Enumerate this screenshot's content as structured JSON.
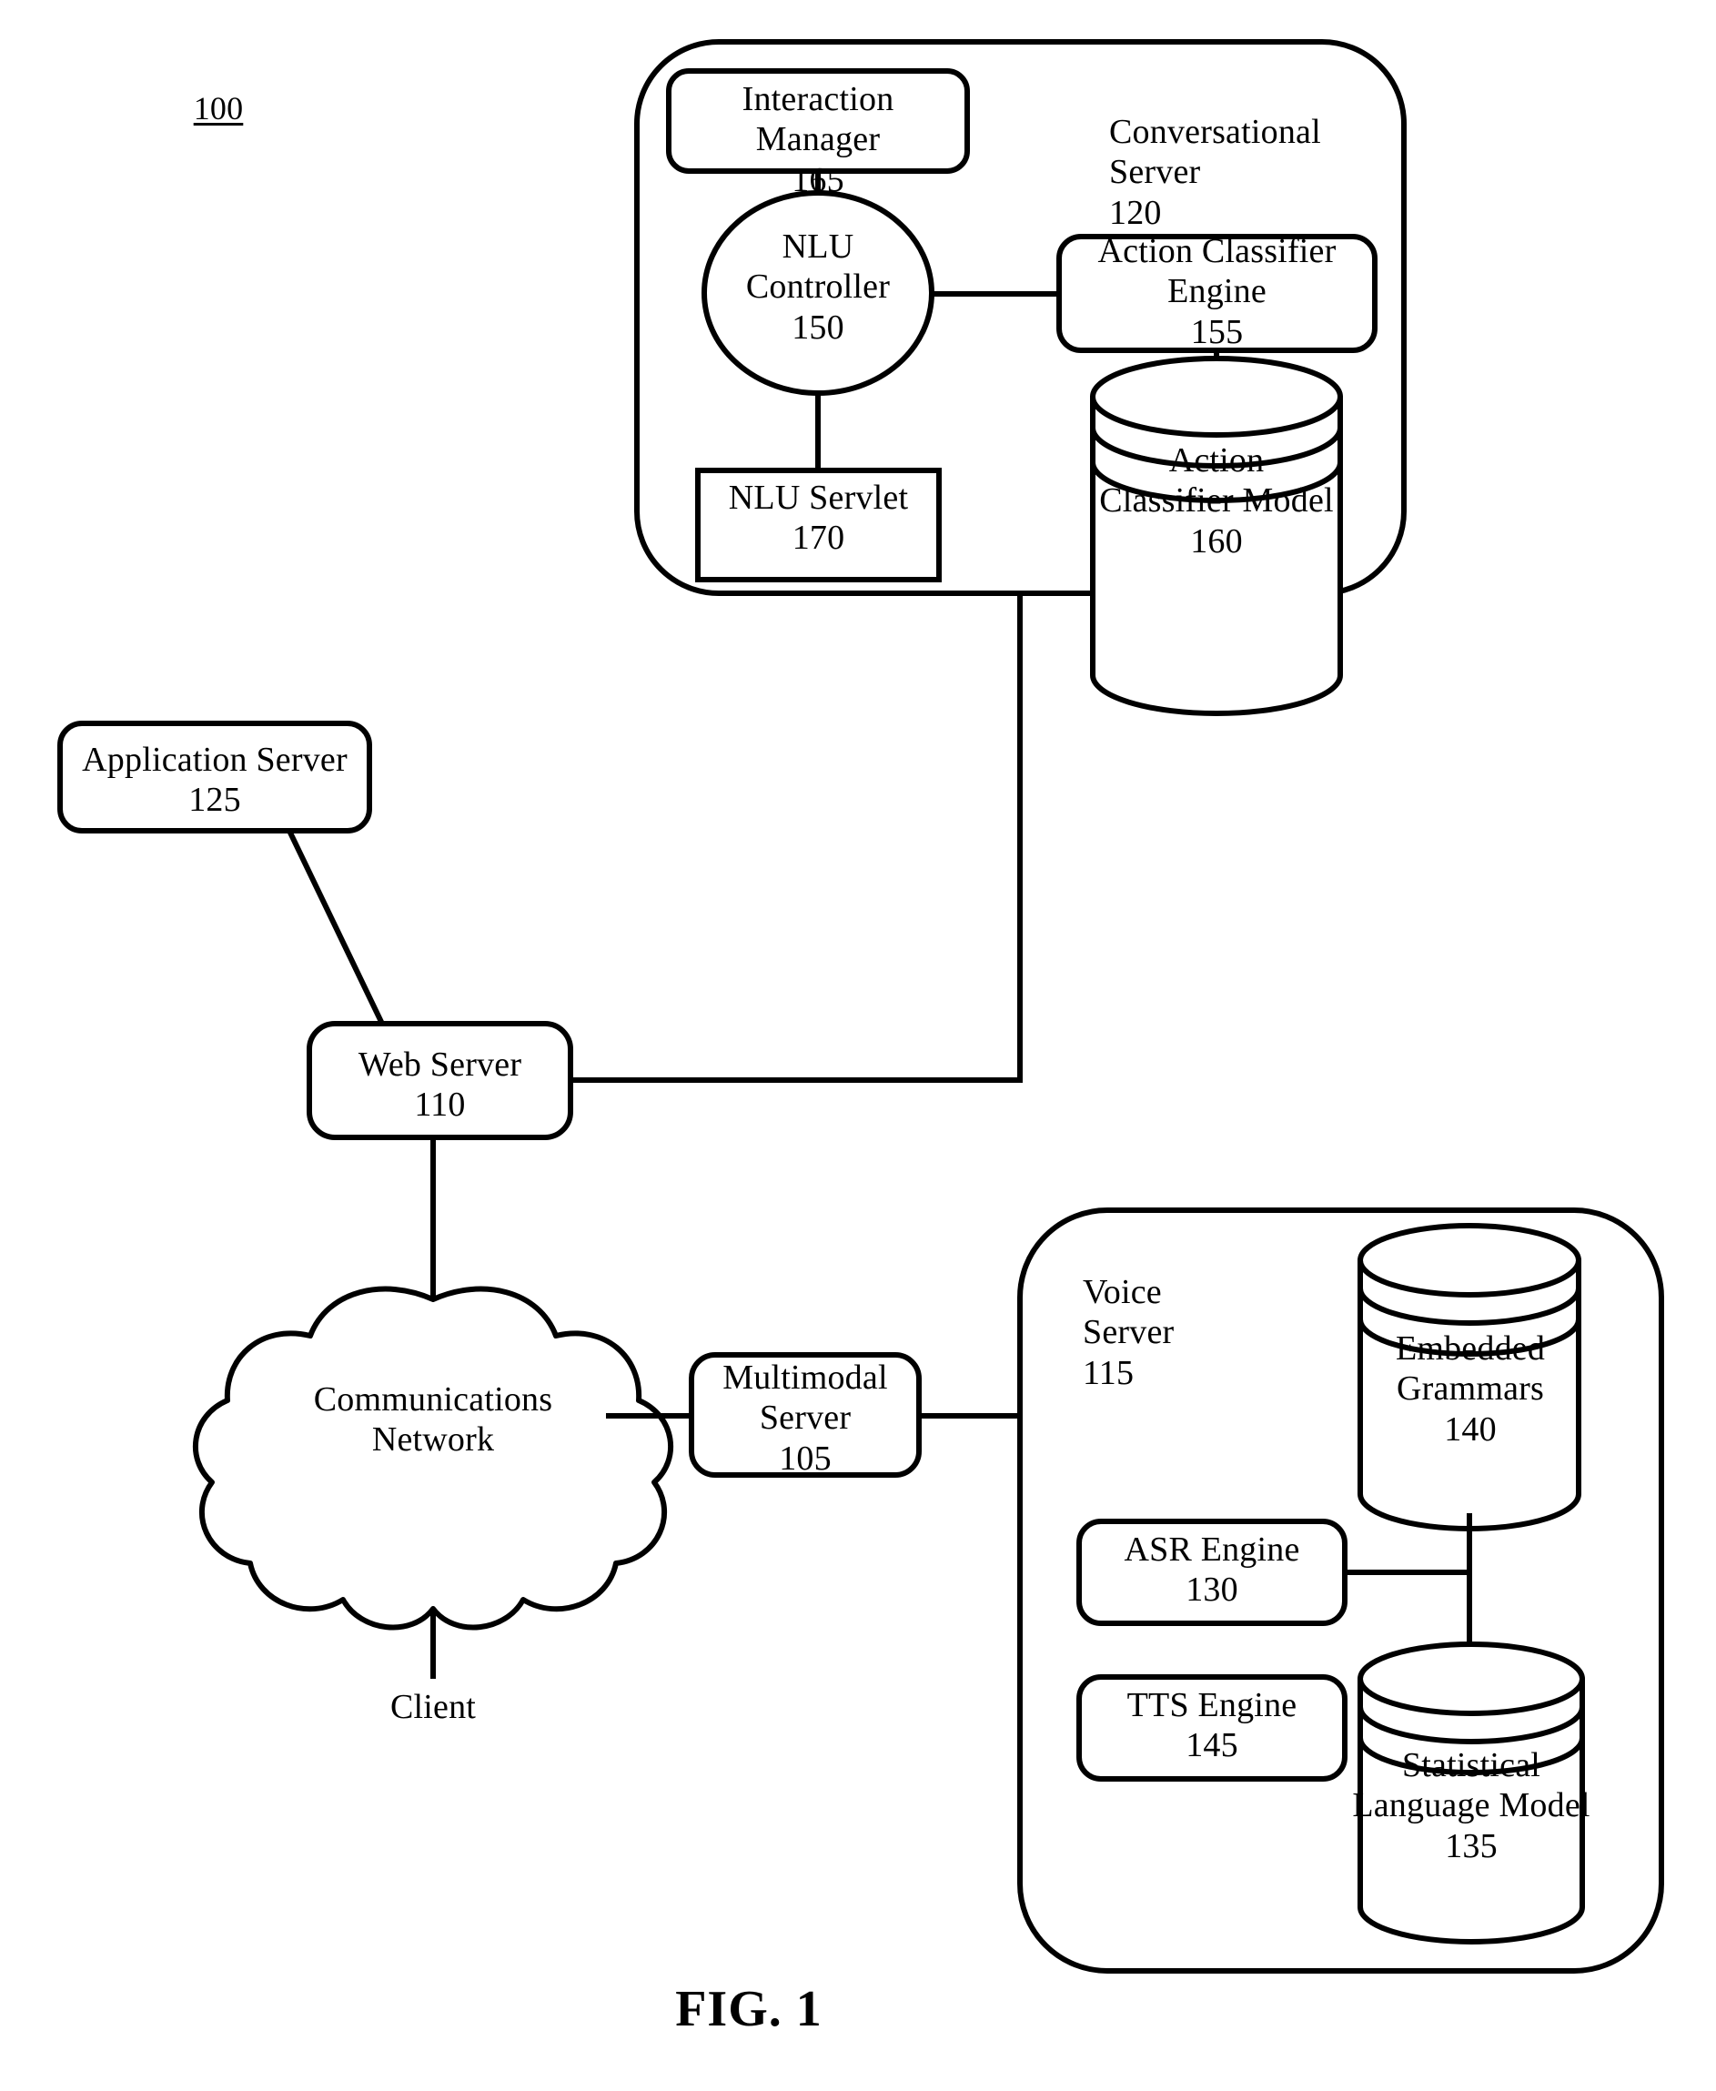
{
  "figure": {
    "reference_numeral": "100",
    "caption": "FIG. 1"
  },
  "containers": {
    "conversational_server": {
      "label": "Conversational\nServer\n120",
      "name": "Conversational Server",
      "numeral": "120"
    },
    "voice_server": {
      "label": "Voice\nServer\n115",
      "name": "Voice Server",
      "numeral": "115"
    }
  },
  "nodes": {
    "interaction_manager": {
      "label": "Interaction\nManager\n165",
      "numeral": "165",
      "shape": "rounded-rect"
    },
    "nlu_controller": {
      "label": "NLU\nController\n150",
      "numeral": "150",
      "shape": "ellipse"
    },
    "action_classifier_engine": {
      "label": "Action Classifier\nEngine\n155",
      "numeral": "155",
      "shape": "rounded-rect"
    },
    "action_classifier_model": {
      "label": "Action\nClassifier Model\n160",
      "numeral": "160",
      "shape": "cylinder"
    },
    "nlu_servlet": {
      "label": "NLU Servlet\n170",
      "numeral": "170",
      "shape": "rect"
    },
    "application_server": {
      "label": "Application Server\n125",
      "numeral": "125",
      "shape": "rounded-rect"
    },
    "web_server": {
      "label": "Web Server\n110",
      "numeral": "110",
      "shape": "rounded-rect"
    },
    "communications_network": {
      "label": "Communications\nNetwork",
      "numeral": "",
      "shape": "cloud"
    },
    "client": {
      "label": "Client",
      "numeral": "",
      "shape": "text"
    },
    "multimodal_server": {
      "label": "Multimodal\nServer\n105",
      "numeral": "105",
      "shape": "rounded-rect"
    },
    "embedded_grammars": {
      "label": "Embedded\nGrammars\n140",
      "numeral": "140",
      "shape": "cylinder"
    },
    "asr_engine": {
      "label": "ASR Engine\n130",
      "numeral": "130",
      "shape": "rounded-rect"
    },
    "tts_engine": {
      "label": "TTS Engine\n145",
      "numeral": "145",
      "shape": "rounded-rect"
    },
    "statistical_language_model": {
      "label": "Statistical\nLanguage Model\n135",
      "numeral": "135",
      "shape": "cylinder"
    }
  },
  "connections": [
    {
      "from": "interaction_manager",
      "to": "nlu_controller"
    },
    {
      "from": "nlu_controller",
      "to": "action_classifier_engine"
    },
    {
      "from": "nlu_controller",
      "to": "nlu_servlet"
    },
    {
      "from": "action_classifier_engine",
      "to": "action_classifier_model"
    },
    {
      "from": "conversational_server",
      "to": "web_server"
    },
    {
      "from": "application_server",
      "to": "web_server"
    },
    {
      "from": "web_server",
      "to": "communications_network"
    },
    {
      "from": "communications_network",
      "to": "client"
    },
    {
      "from": "communications_network",
      "to": "multimodal_server"
    },
    {
      "from": "multimodal_server",
      "to": "voice_server"
    },
    {
      "from": "asr_engine",
      "to": "embedded_grammars"
    },
    {
      "from": "asr_engine",
      "to": "statistical_language_model"
    }
  ],
  "colors": {
    "stroke": "#000000",
    "background": "#ffffff"
  }
}
